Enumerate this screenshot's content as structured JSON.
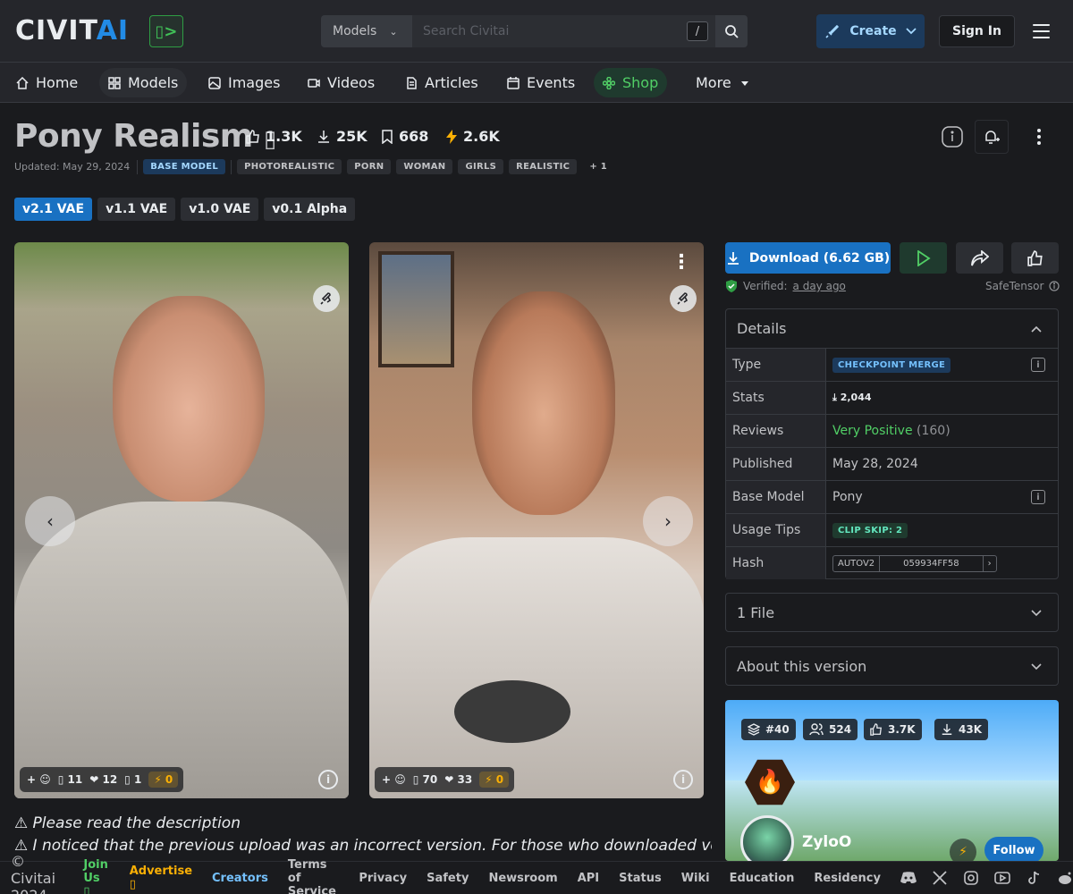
{
  "header": {
    "logo_main": "CIVIT",
    "logo_accent": "AI",
    "badge_glyph": "▯>",
    "search_scope": "Models",
    "search_placeholder": "Search Civitai",
    "search_shortcut": "/",
    "create_label": "Create",
    "signin_label": "Sign In"
  },
  "nav": {
    "items": [
      {
        "label": "Home",
        "icon": "home-icon"
      },
      {
        "label": "Models",
        "icon": "grid-icon"
      },
      {
        "label": "Images",
        "icon": "image-icon"
      },
      {
        "label": "Videos",
        "icon": "video-icon"
      },
      {
        "label": "Articles",
        "icon": "article-icon"
      },
      {
        "label": "Events",
        "icon": "calendar-icon"
      },
      {
        "label": "Shop",
        "icon": "shop-icon"
      },
      {
        "label": "More",
        "icon": "caret-down-icon"
      }
    ]
  },
  "model": {
    "title": "Pony Realism",
    "title_glyph": "▯",
    "likes": "1.3K",
    "downloads": "25K",
    "bookmarks": "668",
    "buzz": "2.6K",
    "updated": "Updated: May 29, 2024",
    "base_tag": "BASE MODEL",
    "tags": [
      "PHOTOREALISTIC",
      "PORN",
      "WOMAN",
      "GIRLS",
      "REALISTIC"
    ],
    "more_tags": "+ 1",
    "versions": [
      "v2.1 VAE",
      "v1.1 VAE",
      "v1.0 VAE",
      "v0.1 Alpha"
    ],
    "active_version": "v2.1 VAE"
  },
  "gallery": [
    {
      "add": "+",
      "comments": "11",
      "hearts": "12",
      "other": "1",
      "buzz": "0"
    },
    {
      "add": "+",
      "comments": "70",
      "hearts": "33",
      "buzz": "0"
    }
  ],
  "description": {
    "line1": "⚠ Please read the description",
    "line2": "⚠ I noticed that the previous upload was an incorrect version. For those who downloaded version"
  },
  "sidebar": {
    "download_label": "Download (6.62 GB)",
    "verified_label": "Verified:",
    "verified_when": "a day ago",
    "safetensor": "SafeTensor",
    "details_title": "Details",
    "details": {
      "type_k": "Type",
      "type_v": "CHECKPOINT MERGE",
      "stats_k": "Stats",
      "stats_v": "2,044",
      "reviews_k": "Reviews",
      "reviews_v": "Very Positive",
      "reviews_count": "(160)",
      "published_k": "Published",
      "published_v": "May 28, 2024",
      "base_k": "Base Model",
      "base_v": "Pony",
      "tips_k": "Usage Tips",
      "tips_v": "CLIP SKIP: 2",
      "hash_k": "Hash",
      "hash_algo": "AUTOV2",
      "hash_v": "059934FF58",
      "hash_next": "›"
    },
    "files_title": "1 File",
    "about_title": "About this version"
  },
  "creator": {
    "rank": "#40",
    "followers": "524",
    "likes": "3.7K",
    "downloads": "43K",
    "name": "ZyloO",
    "follow_label": "Follow"
  },
  "footer": {
    "copyright": "© Civitai 2024",
    "links": [
      "Join Us ▯",
      "Advertise ▯",
      "Creators",
      "Terms of Service",
      "Privacy",
      "Safety",
      "Newsroom",
      "API",
      "Status",
      "Wiki",
      "Education",
      "Residency"
    ],
    "social_icons": [
      "discord-icon",
      "x-icon",
      "instagram-icon",
      "youtube-icon",
      "tiktok-icon",
      "reddit-icon"
    ]
  },
  "colors": {
    "accent": "#1971c2",
    "positive": "#51cf66",
    "buzz": "#fab005"
  }
}
